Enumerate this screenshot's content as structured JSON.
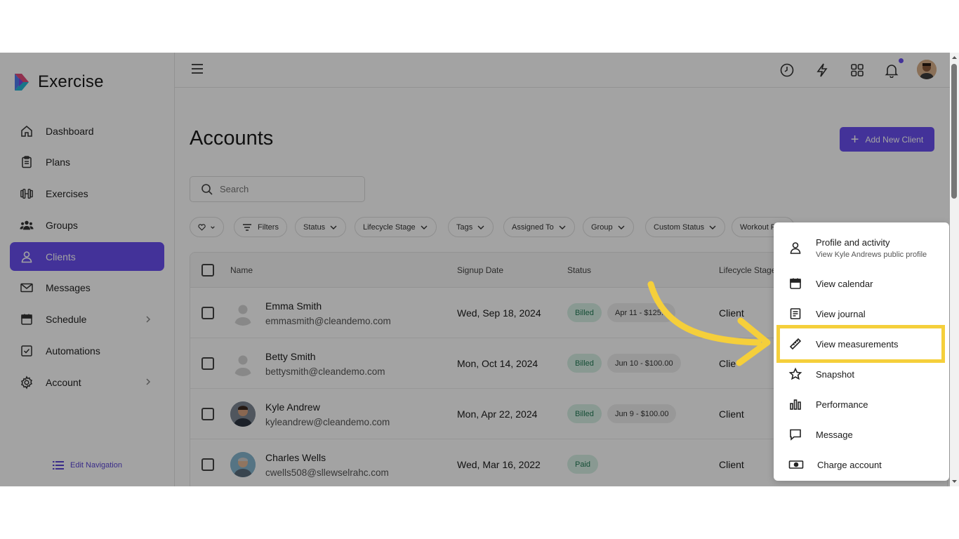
{
  "app": {
    "name": "Exercise"
  },
  "sidebar": {
    "items": [
      {
        "label": "Dashboard",
        "icon": "home-icon"
      },
      {
        "label": "Plans",
        "icon": "clipboard-icon"
      },
      {
        "label": "Exercises",
        "icon": "dumbbell-icon"
      },
      {
        "label": "Groups",
        "icon": "users-icon"
      },
      {
        "label": "Clients",
        "icon": "user-icon",
        "active": true
      },
      {
        "label": "Messages",
        "icon": "mail-icon"
      },
      {
        "label": "Schedule",
        "icon": "calendar-icon",
        "has_submenu": true
      },
      {
        "label": "Automations",
        "icon": "checkbox-icon"
      },
      {
        "label": "Account",
        "icon": "gear-icon",
        "has_submenu": true
      }
    ],
    "edit_navigation": "Edit Navigation"
  },
  "header": {
    "icons": [
      "history-icon",
      "bolt-icon",
      "apps-grid-icon",
      "bell-icon",
      "avatar"
    ]
  },
  "main": {
    "title": "Accounts",
    "add_button": "Add New Client",
    "search_placeholder": "Search",
    "filters": [
      {
        "label": "",
        "icon": "heart-icon"
      },
      {
        "label": "Filters",
        "icon": "filter-icon"
      },
      {
        "label": "Status"
      },
      {
        "label": "Lifecycle Stage"
      },
      {
        "label": "Tags"
      },
      {
        "label": "Assigned To"
      },
      {
        "label": "Group"
      },
      {
        "label": "Custom Status"
      },
      {
        "label": "Workout P"
      }
    ],
    "table": {
      "columns": [
        "Name",
        "Signup Date",
        "Status",
        "Lifecycle Stage"
      ],
      "rows": [
        {
          "name": "Emma Smith",
          "email": "emmasmith@cleandemo.com",
          "signup": "Wed, Sep 18, 2024",
          "status": "Billed",
          "plan": "Apr 11 - $125.0",
          "stage": "Client"
        },
        {
          "name": "Betty Smith",
          "email": "bettysmith@cleandemo.com",
          "signup": "Mon, Oct 14, 2024",
          "status": "Billed",
          "plan": "Jun 10 - $100.00",
          "stage": "Clie"
        },
        {
          "name": "Kyle Andrew",
          "email": "kyleandrew@cleandemo.com",
          "signup": "Mon, Apr 22, 2024",
          "status": "Billed",
          "plan": "Jun 9 - $100.00",
          "stage": "Client"
        },
        {
          "name": "Charles Wells",
          "email": "cwells508@sllewselrahc.com",
          "signup": "Wed, Mar 16, 2022",
          "status": "Paid",
          "plan": "",
          "stage": "Client"
        }
      ]
    }
  },
  "context_menu": {
    "items": [
      {
        "label": "Profile and activity",
        "sub": "View Kyle Andrews public profile",
        "icon": "user-icon"
      },
      {
        "label": "View calendar",
        "icon": "calendar-icon"
      },
      {
        "label": "View journal",
        "icon": "journal-icon"
      },
      {
        "label": "View measurements",
        "icon": "ruler-icon",
        "highlighted": true
      },
      {
        "label": "Snapshot",
        "icon": "star-icon"
      },
      {
        "label": "Performance",
        "icon": "bar-chart-icon"
      },
      {
        "label": "Message",
        "icon": "message-icon"
      },
      {
        "label": "Charge account",
        "icon": "cash-icon"
      }
    ]
  },
  "colors": {
    "accent": "#6a4ff0",
    "highlight": "#f5cf3b",
    "billed_bg": "#d7f0e5"
  }
}
